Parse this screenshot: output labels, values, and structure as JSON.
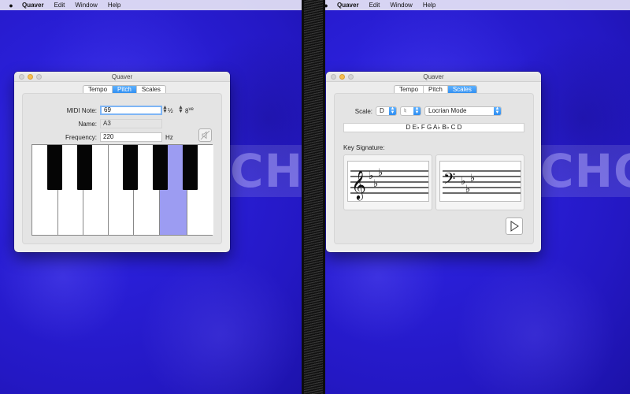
{
  "menubar": {
    "apple_icon": "apple-icon",
    "app_name": "Quaver",
    "items": [
      "Edit",
      "Window",
      "Help"
    ]
  },
  "background_text": "CHO",
  "pitch_window": {
    "title": "Quaver",
    "tabs": [
      "Tempo",
      "Pitch",
      "Scales"
    ],
    "selected_tab": "Pitch",
    "midi_note_label": "MIDI Note:",
    "midi_note_value": "69",
    "half_step_label": "½",
    "octave_label": "8",
    "octave_sup": "ve",
    "name_label": "Name:",
    "name_value": "A3",
    "frequency_label": "Frequency:",
    "frequency_value": "220",
    "frequency_unit": "Hz",
    "mute_icon": "speaker-muted-icon",
    "selected_key": "A"
  },
  "scales_window": {
    "title": "Quaver",
    "tabs": [
      "Tempo",
      "Pitch",
      "Scales"
    ],
    "selected_tab": "Scales",
    "scale_label": "Scale:",
    "root_note": "D",
    "accidental": "♮",
    "mode": "Locrian Mode",
    "scale_notes": "D  E♭  F  G  A♭  B♭  C  D",
    "key_signature_label": "Key Signature:",
    "play_icon": "play-icon"
  },
  "colors": {
    "desktop": "#2a1fd8",
    "selection_blue": "#2d8cf0",
    "selected_key": "#9c9cf2"
  }
}
